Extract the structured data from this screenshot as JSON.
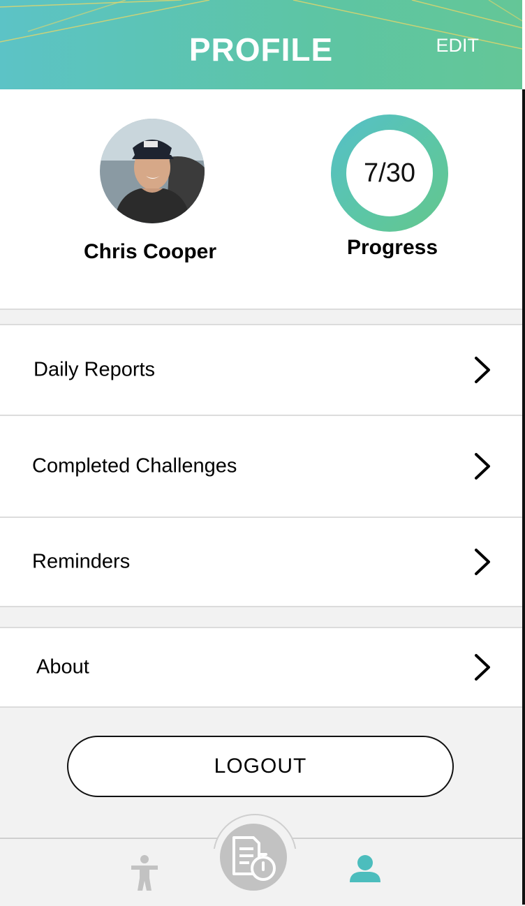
{
  "header": {
    "title": "PROFILE",
    "edit_label": "EDIT",
    "gradient_start": "#5cc3c6",
    "gradient_end": "#64c697"
  },
  "profile": {
    "name": "Chris Cooper",
    "progress_value": "7/30",
    "progress_label": "Progress",
    "accent": "#5cc6a6"
  },
  "menu": {
    "group1": [
      {
        "label": "Daily Reports",
        "icon": "chevron-right-icon"
      },
      {
        "label": "Completed Challenges",
        "icon": "chevron-right-icon"
      },
      {
        "label": "Reminders",
        "icon": "chevron-right-icon"
      }
    ],
    "group2": [
      {
        "label": "About",
        "icon": "chevron-right-icon"
      }
    ]
  },
  "logout_label": "LOGOUT",
  "tabbar": {
    "tabs": [
      {
        "icon": "person-stretch-icon",
        "active": false
      },
      {
        "icon": "report-timer-icon",
        "active": false
      },
      {
        "icon": "user-profile-icon",
        "active": true
      }
    ],
    "active_color": "#4cbdbd",
    "inactive_color": "#c2c2c2"
  }
}
